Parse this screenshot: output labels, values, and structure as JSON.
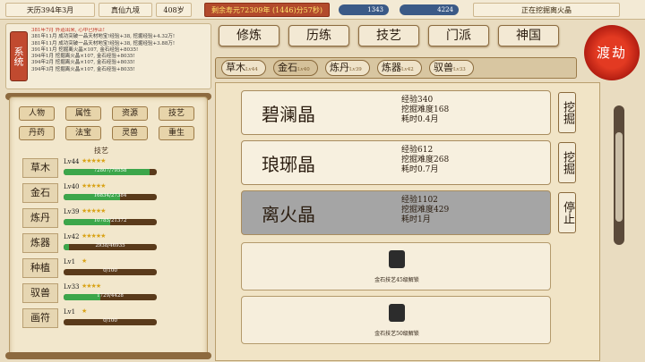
{
  "topbar": {
    "date": "天历394年3月",
    "realm": "真仙九境",
    "age": "408岁",
    "life": "剩余寿元72309年 (1446)分57秒)",
    "spirit_stone": "1343",
    "herbs": "4224",
    "digging": "正在挖掘离火晶"
  },
  "log": {
    "sys_label": "系统",
    "lines": [
      "381年7月 外道出来, 心中已停止!",
      "381年11月 成功突破一品天材地宝!经验+38, 挖掘经验+4.32万!",
      "381年11月 成功突破一品天材地宝!经验+38, 挖掘经验+3.88万!",
      "391年11月 挖掘离火晶×107, 金石经验+8035!",
      "394年1月 挖掘离火晶×107, 金石经验+8035!",
      "394年2月 挖掘离火晶×107, 金石经验+8035!",
      "394年3月 挖掘离火晶×107, 金石经验+8035!"
    ]
  },
  "categories": [
    "人物",
    "属性",
    "资源",
    "技艺",
    "丹药",
    "法宝",
    "灵兽",
    "重生"
  ],
  "skill_header": "技艺",
  "skills": [
    {
      "name": "草木",
      "lv": "Lv44",
      "stars": "★★★★★",
      "progress": "72807/79558",
      "pct": 0.92
    },
    {
      "name": "金石",
      "lv": "Lv40",
      "stars": "★★★★★",
      "progress": "16834/27384",
      "pct": 0.61
    },
    {
      "name": "炼丹",
      "lv": "Lv39",
      "stars": "★★★★★",
      "progress": "10785/21372",
      "pct": 0.5
    },
    {
      "name": "炼器",
      "lv": "Lv42",
      "stars": "★★★★★",
      "progress": "2938/46935",
      "pct": 0.06
    },
    {
      "name": "种植",
      "lv": "Lv1",
      "stars": "★",
      "progress": "0/100",
      "pct": 0
    },
    {
      "name": "驭兽",
      "lv": "Lv33",
      "stars": "★★★★",
      "progress": "1729/4428",
      "pct": 0.39
    },
    {
      "name": "画符",
      "lv": "Lv1",
      "stars": "★",
      "progress": "0/100",
      "pct": 0
    }
  ],
  "tabs": [
    "修炼",
    "历练",
    "技艺",
    "门派",
    "神国"
  ],
  "crisis": "渡劫",
  "subtabs": [
    {
      "name": "草木",
      "lv": "Lv44"
    },
    {
      "name": "金石",
      "lv": "Lv40"
    },
    {
      "name": "炼丹",
      "lv": "Lv39"
    },
    {
      "name": "炼器",
      "lv": "Lv42"
    },
    {
      "name": "驭兽",
      "lv": "Lv33"
    }
  ],
  "ores": [
    {
      "name": "碧澜晶",
      "exp": "经验340",
      "diff": "挖掘难度168",
      "time": "耗时0.4月",
      "action": "挖掘"
    },
    {
      "name": "琅琊晶",
      "exp": "经验612",
      "diff": "挖掘难度268",
      "time": "耗时0.7月",
      "action": "挖掘"
    },
    {
      "name": "离火晶",
      "exp": "经验1102",
      "diff": "挖掘难度429",
      "time": "耗时1月",
      "action": "停止"
    }
  ],
  "locked": [
    "金石技艺45级解锁",
    "金石技艺50级解锁"
  ]
}
